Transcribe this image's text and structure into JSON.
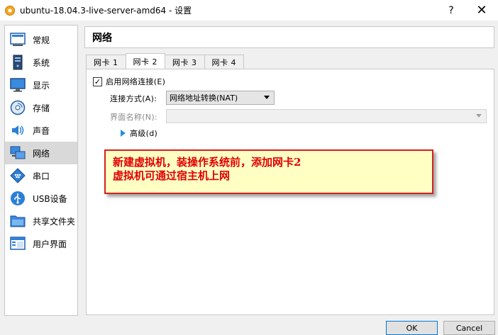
{
  "window": {
    "title": "ubuntu-18.04.3-live-server-amd64 - 设置",
    "help_label": "?",
    "close_label": "✕"
  },
  "sidebar": {
    "items": [
      {
        "label": "常规",
        "icon": "general-icon"
      },
      {
        "label": "系统",
        "icon": "system-icon"
      },
      {
        "label": "显示",
        "icon": "display-icon"
      },
      {
        "label": "存储",
        "icon": "storage-icon"
      },
      {
        "label": "声音",
        "icon": "audio-icon"
      },
      {
        "label": "网络",
        "icon": "network-icon",
        "selected": true
      },
      {
        "label": "串口",
        "icon": "serial-port-icon"
      },
      {
        "label": "USB设备",
        "icon": "usb-icon"
      },
      {
        "label": "共享文件夹",
        "icon": "shared-folder-icon"
      },
      {
        "label": "用户界面",
        "icon": "user-interface-icon"
      }
    ]
  },
  "section": {
    "title": "网络"
  },
  "tabs": [
    {
      "label": "网卡 1"
    },
    {
      "label": "网卡 2",
      "active": true
    },
    {
      "label": "网卡 3"
    },
    {
      "label": "网卡 4"
    }
  ],
  "network": {
    "enable_label": "启用网络连接(E)",
    "enable_checked": "✓",
    "attach_label": "连接方式(A):",
    "attach_value": "网络地址转换(NAT)",
    "name_label": "界面名称(N):",
    "name_value": "",
    "advanced_label": "高级(d)"
  },
  "annotation": {
    "line1": "新建虚拟机，装操作系统前，添加网卡2",
    "line2": "虚拟机可通过宿主机上网",
    "text_color": "#e00000",
    "border_color": "#d42020",
    "background": "#ffffc4"
  },
  "buttons": {
    "ok": "OK",
    "cancel": "Cancel"
  }
}
